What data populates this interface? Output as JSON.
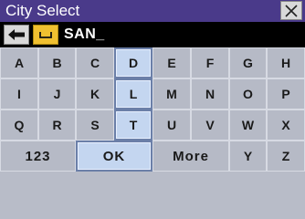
{
  "window": {
    "title": "City Select",
    "close_icon": "close-x-icon"
  },
  "entry": {
    "back_icon": "left-arrow-icon",
    "space_icon": "space-bar-icon",
    "text": "SAN_"
  },
  "keyboard": {
    "rows": [
      [
        "A",
        "B",
        "C",
        "D",
        "E",
        "F",
        "G",
        "H"
      ],
      [
        "I",
        "J",
        "K",
        "L",
        "M",
        "N",
        "O",
        "P"
      ],
      [
        "Q",
        "R",
        "S",
        "T",
        "U",
        "V",
        "W",
        "X"
      ]
    ],
    "bottom": {
      "numbers": "123",
      "ok": "OK",
      "more": "More",
      "y": "Y",
      "z": "Z"
    },
    "highlighted_keys": [
      "D",
      "L",
      "T",
      "OK"
    ]
  },
  "colors": {
    "title_bar": "#4a3a8a",
    "space_key": "#f0c030",
    "key_bg": "#b6bac6",
    "key_highlight": "#c4d6f0"
  }
}
